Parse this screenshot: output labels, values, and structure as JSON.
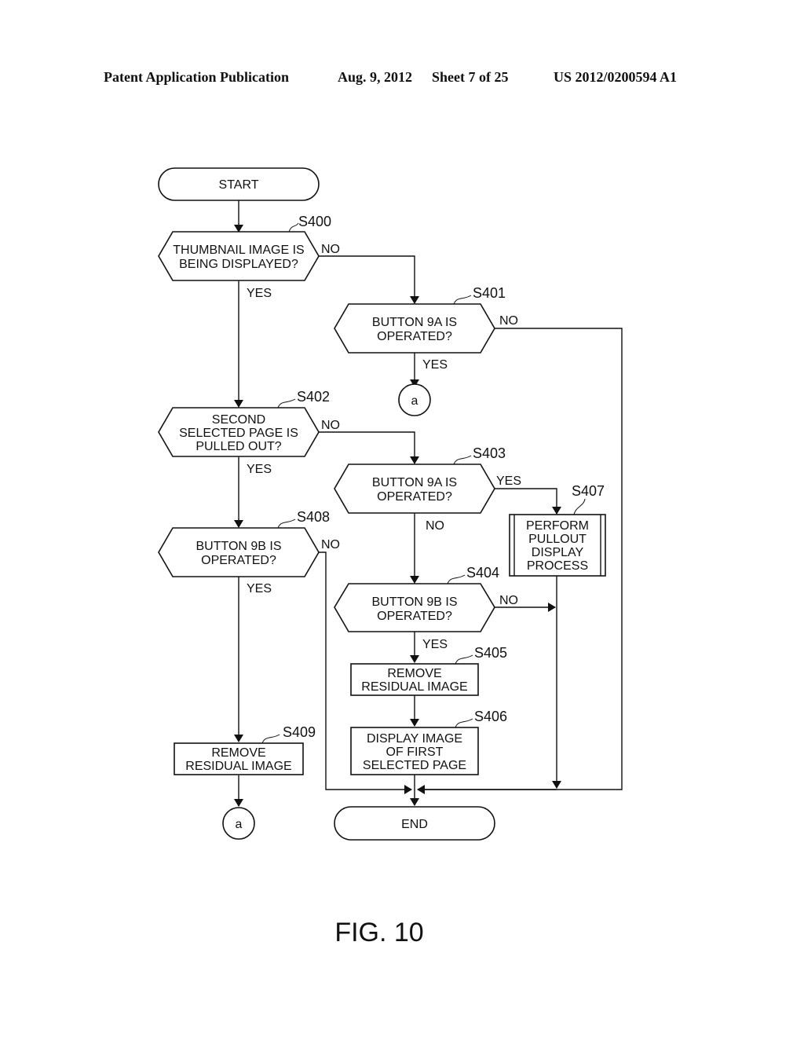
{
  "header": {
    "publication": "Patent Application Publication",
    "date": "Aug. 9, 2012",
    "sheet": "Sheet 7 of 25",
    "number": "US 2012/0200594 A1"
  },
  "figure_label": "FIG. 10",
  "nodes": {
    "start": {
      "lines": [
        "START"
      ]
    },
    "s400": {
      "step": "S400",
      "lines": [
        "THUMBNAIL IMAGE IS",
        "BEING DISPLAYED?"
      ]
    },
    "s401": {
      "step": "S401",
      "lines": [
        "BUTTON 9A IS",
        "OPERATED?"
      ]
    },
    "conn_a1": {
      "lines": [
        "a"
      ]
    },
    "s402": {
      "step": "S402",
      "lines": [
        "SECOND",
        "SELECTED PAGE IS",
        "PULLED OUT?"
      ]
    },
    "s403": {
      "step": "S403",
      "lines": [
        "BUTTON 9A IS",
        "OPERATED?"
      ]
    },
    "s407": {
      "step": "S407",
      "lines": [
        "PERFORM",
        "PULLOUT",
        "DISPLAY",
        "PROCESS"
      ]
    },
    "s408": {
      "step": "S408",
      "lines": [
        "BUTTON 9B IS",
        "OPERATED?"
      ]
    },
    "s404": {
      "step": "S404",
      "lines": [
        "BUTTON 9B IS",
        "OPERATED?"
      ]
    },
    "s405": {
      "step": "S405",
      "lines": [
        "REMOVE",
        "RESIDUAL IMAGE"
      ]
    },
    "s406": {
      "step": "S406",
      "lines": [
        "DISPLAY IMAGE",
        "OF FIRST",
        "SELECTED PAGE"
      ]
    },
    "s409": {
      "step": "S409",
      "lines": [
        "REMOVE",
        "RESIDUAL IMAGE"
      ]
    },
    "conn_a2": {
      "lines": [
        "a"
      ]
    },
    "end": {
      "lines": [
        "END"
      ]
    }
  },
  "branch_labels": {
    "s400_no": "NO",
    "s400_yes": "YES",
    "s401_no": "NO",
    "s401_yes": "YES",
    "s402_no": "NO",
    "s402_yes": "YES",
    "s403_yes": "YES",
    "s403_no": "NO",
    "s408_no": "NO",
    "s408_yes": "YES",
    "s404_no": "NO",
    "s404_yes": "YES"
  }
}
